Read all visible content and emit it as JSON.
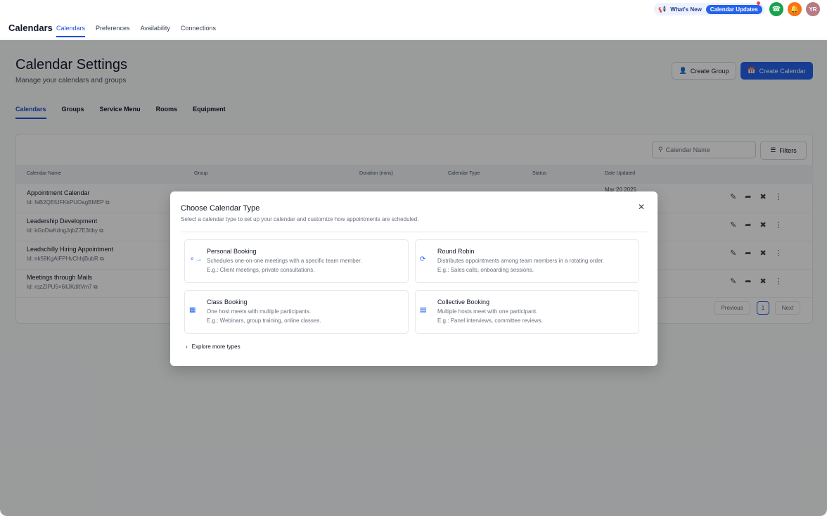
{
  "app": {
    "title": "Calendars"
  },
  "topnav": [
    "Calendars",
    "Preferences",
    "Availability",
    "Connections"
  ],
  "header_right": {
    "whats_new": "What's New",
    "updates": "Calendar Updates",
    "avatar": "YR"
  },
  "page": {
    "title": "Calendar Settings",
    "subtitle": "Manage your calendars and groups",
    "create_group": "Create Group",
    "create_calendar": "Create Calendar"
  },
  "subtabs": [
    "Calendars",
    "Groups",
    "Service Menu",
    "Rooms",
    "Equipment"
  ],
  "table": {
    "search_placeholder": "Calendar Name",
    "filters": "Filters",
    "columns": [
      "Calendar Name",
      "Group",
      "Duration (mins)",
      "Calendar Type",
      "Status",
      "Date Updated"
    ],
    "rows": [
      {
        "name": "Appointment Calendar",
        "id": "Id: feB2QElUFKkPUOagBMEP",
        "date": "Mar 20 2025"
      },
      {
        "name": "Leadership Development",
        "id": "Id: kGnDwKdngJqbZ7E3ttby"
      },
      {
        "name": "Leadschilly Hiring Appointment",
        "id": "Id: nk59KgAlFPHvChhjBubR"
      },
      {
        "name": "Meetings through Mails",
        "id": "Id: rqzZIPU5×6itJKdItVm7"
      }
    ],
    "pager": {
      "previous": "Previous",
      "page": "1",
      "next": "Next"
    }
  },
  "modal": {
    "title": "Choose Calendar Type",
    "subtitle": "Select a calendar type to set up your calendar and customize how appointments are scheduled.",
    "types": [
      {
        "title": "Personal Booking",
        "desc": "Schedules one-on-one meetings with a specific team member.",
        "eg": "E.g.: Client meetings, private consultations.",
        "icon": "one-on-one-icon"
      },
      {
        "title": "Round Robin",
        "desc": "Distributes appointments among team members in a rotating order.",
        "eg": "E.g.: Sales calls, onboarding sessions.",
        "icon": "round-robin-icon"
      },
      {
        "title": "Class Booking",
        "desc": "One host meets with multiple participants.",
        "eg": "E.g.: Webinars, group training, online classes.",
        "icon": "class-icon"
      },
      {
        "title": "Collective Booking",
        "desc": "Multiple hosts meet with one participant.",
        "eg": "E.g.: Panel interviews, committee reviews.",
        "icon": "collective-icon"
      }
    ],
    "explore": "Explore more types"
  },
  "colors": {
    "accent": "#2563eb",
    "overlay": "rgba(0,0,0,0.38)"
  }
}
